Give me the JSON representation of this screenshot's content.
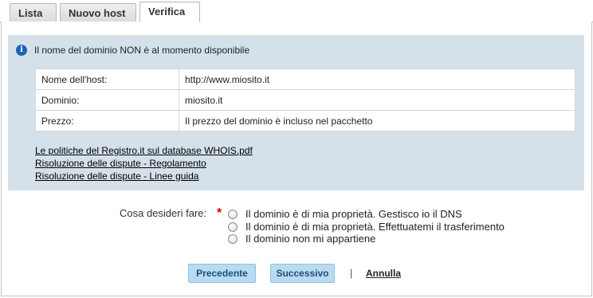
{
  "tabs": [
    {
      "label": "Lista"
    },
    {
      "label": "Nuovo host"
    },
    {
      "label": "Verifica",
      "active": true
    }
  ],
  "notice": {
    "icon": "info-icon",
    "text": "Il nome del dominio NON è al momento disponibile"
  },
  "details": [
    {
      "label": "Nome dell'host:",
      "value": "http://www.miosito.it"
    },
    {
      "label": "Dominio:",
      "value": "miosito.it"
    },
    {
      "label": "Prezzo:",
      "value": "Il prezzo del dominio è incluso nel pacchetto"
    }
  ],
  "links": [
    "Le politiche del Registro.it sul database WHOIS.pdf",
    "Risoluzione delle dispute - Regolamento",
    "Risoluzione delle dispute - Linee guida"
  ],
  "choice": {
    "label": "Cosa desideri fare:",
    "required_mark": "*",
    "options": [
      "Il dominio è di mia proprietà. Gestisco io il DNS",
      "Il dominio è di mia proprietà. Effettuatemi il trasferimento",
      "Il dominio non mi appartiene"
    ]
  },
  "buttons": {
    "previous": "Precedente",
    "next": "Successivo",
    "separator": "|",
    "cancel": "Annulla"
  },
  "colors": {
    "info_box_bg": "#d5e1ea",
    "button_bg": "#b9daf0",
    "button_text": "#1a4f7d",
    "required": "#d40000",
    "info_icon": "#1f63b0"
  }
}
